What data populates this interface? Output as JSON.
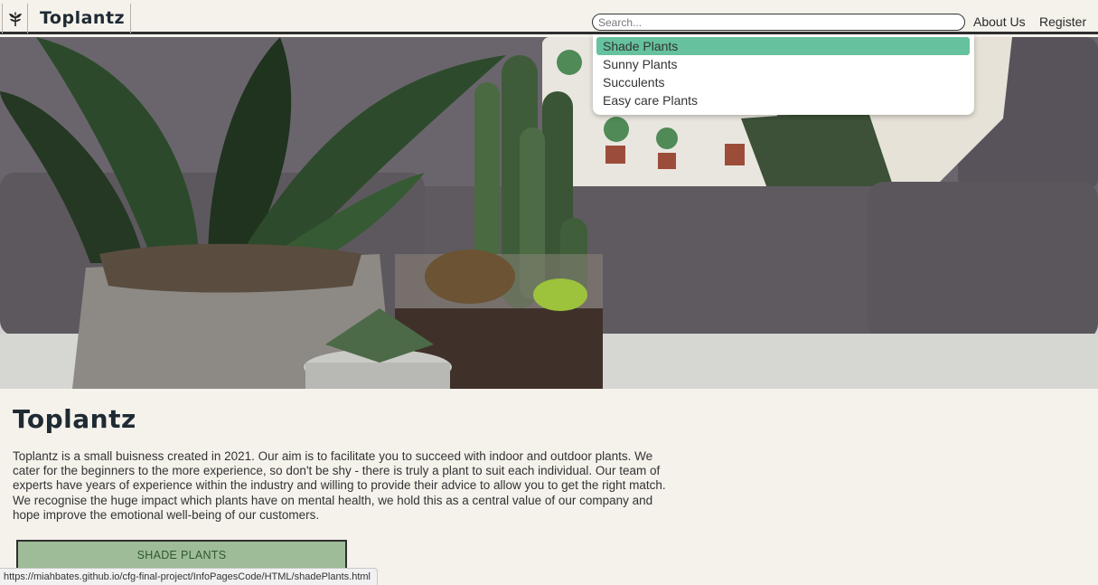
{
  "nav": {
    "brand": "Toplantz",
    "search_placeholder": "Search...",
    "links": [
      "About Us",
      "Register"
    ]
  },
  "dropdown": {
    "items": [
      "Shade Plants",
      "Sunny Plants",
      "Succulents",
      "Easy care Plants"
    ],
    "active_index": 0
  },
  "main": {
    "title": "Toplantz",
    "description": "Toplantz is a small buisness created in 2021. Our aim is to facilitate you to succeed with indoor and outdoor plants. We cater for the beginners to the more experience, so don't be shy - there is truly a plant to suit each individual. Our team of experts have years of experience within the industry and willing to provide their advice to allow you to get the right match. We recognise the huge impact which plants have on mental health, we hold this as a central value of our company and hope improve the emotional well-being of our customers.",
    "cta_label": "SHADE PLANTS"
  },
  "status_bar": {
    "url": "https://miahbates.github.io/cfg-final-project/InfoPagesCode/HTML/shadePlants.html"
  },
  "icons": {
    "logo": "leaf-plant-icon"
  },
  "colors": {
    "background": "#f5f2ec",
    "accent": "#66c29e",
    "button": "#9fbc98",
    "brand_text": "#1f2a33"
  }
}
